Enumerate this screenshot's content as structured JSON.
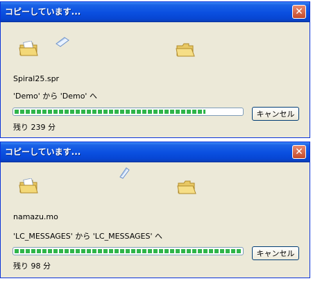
{
  "dialogs": [
    {
      "title": "コピーしています...",
      "close_glyph": "✕",
      "file_name": "Spiral25.spr",
      "from_to": "'Demo' から 'Demo' へ",
      "progress_fraction": 0.84,
      "cancel_label": "キャンセル",
      "remaining": "残り 239 分"
    },
    {
      "title": "コピーしています...",
      "close_glyph": "✕",
      "file_name": "namazu.mo",
      "from_to": "'LC_MESSAGES' から 'LC_MESSAGES' へ",
      "progress_fraction": 1.0,
      "cancel_label": "キャンセル",
      "remaining": "残り 98 分"
    }
  ],
  "colors": {
    "titlebar": "#0a4fe0",
    "dialog_bg": "#ece9d8",
    "progress_fill": "#2fb54a",
    "close_button": "#c44a2a"
  },
  "icons": [
    "source-folder-icon",
    "flying-paper-icon",
    "destination-folder-icon",
    "close-icon"
  ]
}
